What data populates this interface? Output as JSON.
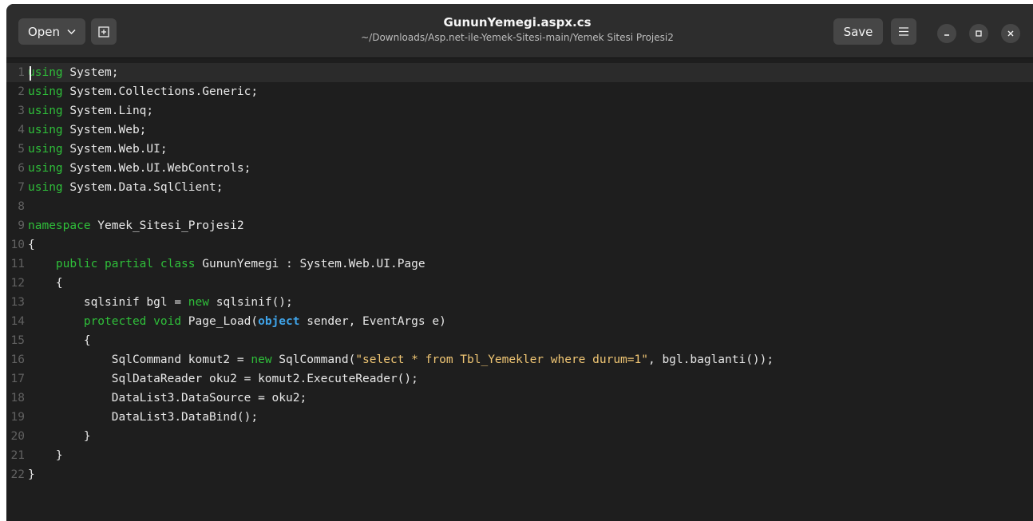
{
  "titlebar": {
    "open_label": "Open",
    "save_label": "Save",
    "title": "GununYemegi.aspx.cs",
    "path": "~/Downloads/Asp.net-ile-Yemek-Sitesi-main/Yemek Sitesi Projesi2"
  },
  "icons": {
    "open_dropdown": "chevron-down-icon",
    "pin": "new-tab-icon",
    "menu": "hamburger-menu-icon",
    "minimize": "minimize-icon",
    "maximize": "maximize-icon",
    "close": "close-icon"
  },
  "colors": {
    "keyword": "#2fbf3a",
    "type_keyword": "#3fa3e8",
    "string": "#f0c674",
    "text": "#e8e8e8",
    "line_number": "#616161",
    "background": "#1e1e1e"
  },
  "editor": {
    "current_line": 1,
    "lines": [
      {
        "n": "1",
        "tokens": [
          [
            "kw",
            "using"
          ],
          [
            "",
            " System;"
          ]
        ]
      },
      {
        "n": "2",
        "tokens": [
          [
            "kw",
            "using"
          ],
          [
            "",
            " System.Collections.Generic;"
          ]
        ]
      },
      {
        "n": "3",
        "tokens": [
          [
            "kw",
            "using"
          ],
          [
            "",
            " System.Linq;"
          ]
        ]
      },
      {
        "n": "4",
        "tokens": [
          [
            "kw",
            "using"
          ],
          [
            "",
            " System.Web;"
          ]
        ]
      },
      {
        "n": "5",
        "tokens": [
          [
            "kw",
            "using"
          ],
          [
            "",
            " System.Web.UI;"
          ]
        ]
      },
      {
        "n": "6",
        "tokens": [
          [
            "kw",
            "using"
          ],
          [
            "",
            " System.Web.UI.WebControls;"
          ]
        ]
      },
      {
        "n": "7",
        "tokens": [
          [
            "kw",
            "using"
          ],
          [
            "",
            " System.Data.SqlClient;"
          ]
        ]
      },
      {
        "n": "8",
        "tokens": []
      },
      {
        "n": "9",
        "tokens": [
          [
            "kw",
            "namespace"
          ],
          [
            "",
            " Yemek_Sitesi_Projesi2"
          ]
        ]
      },
      {
        "n": "10",
        "tokens": [
          [
            "",
            "{"
          ]
        ]
      },
      {
        "n": "11",
        "tokens": [
          [
            "",
            "    "
          ],
          [
            "kw",
            "public partial class"
          ],
          [
            "",
            " GununYemegi : System.Web.UI.Page"
          ]
        ]
      },
      {
        "n": "12",
        "tokens": [
          [
            "",
            "    {"
          ]
        ]
      },
      {
        "n": "13",
        "tokens": [
          [
            "",
            "        sqlsinif bgl = "
          ],
          [
            "kw",
            "new"
          ],
          [
            "",
            " sqlsinif();"
          ]
        ]
      },
      {
        "n": "14",
        "tokens": [
          [
            "",
            "        "
          ],
          [
            "kw",
            "protected void"
          ],
          [
            "",
            " Page_Load("
          ],
          [
            "kwb",
            "object"
          ],
          [
            "",
            " sender, EventArgs e)"
          ]
        ]
      },
      {
        "n": "15",
        "tokens": [
          [
            "",
            "        {"
          ]
        ]
      },
      {
        "n": "16",
        "tokens": [
          [
            "",
            "            SqlCommand komut2 = "
          ],
          [
            "kw",
            "new"
          ],
          [
            "",
            " SqlCommand("
          ],
          [
            "str",
            "\"select * from Tbl_Yemekler where durum=1\""
          ],
          [
            "",
            ", bgl.baglanti());"
          ]
        ]
      },
      {
        "n": "17",
        "tokens": [
          [
            "",
            "            SqlDataReader oku2 = komut2.ExecuteReader();"
          ]
        ]
      },
      {
        "n": "18",
        "tokens": [
          [
            "",
            "            DataList3.DataSource = oku2;"
          ]
        ]
      },
      {
        "n": "19",
        "tokens": [
          [
            "",
            "            DataList3.DataBind();"
          ]
        ]
      },
      {
        "n": "20",
        "tokens": [
          [
            "",
            "        }"
          ]
        ]
      },
      {
        "n": "21",
        "tokens": [
          [
            "",
            "    }"
          ]
        ]
      },
      {
        "n": "22",
        "tokens": [
          [
            "",
            "}"
          ]
        ]
      }
    ]
  }
}
